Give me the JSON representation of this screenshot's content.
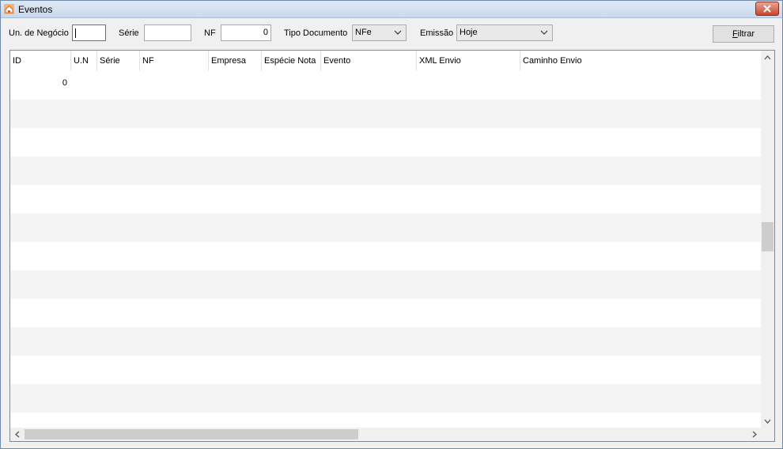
{
  "window": {
    "title": "Eventos",
    "icon": "app-house-icon",
    "close_icon": "close-icon"
  },
  "filters": {
    "unidade_label": "Un. de Negócio",
    "unidade_value": "",
    "serie_label": "Série",
    "serie_value": "",
    "nf_label": "NF",
    "nf_value": "0",
    "tipo_label": "Tipo Documento",
    "tipo_value": "NFe",
    "emissao_label": "Emissão",
    "emissao_value": "Hoje",
    "filtrar_prefix": "F",
    "filtrar_rest": "iltrar"
  },
  "grid": {
    "columns": [
      "ID",
      "U.N",
      "Série",
      "NF",
      "Empresa",
      "Espécie Nota",
      "Evento",
      "XML Envio",
      "Caminho Envio"
    ],
    "rows": [
      {
        "id": "0"
      }
    ],
    "row_colors": {
      "normal": "#ffffff",
      "alternate": "#f3f3f3"
    }
  },
  "scroll": {
    "vertical_position": 0.48,
    "horizontal_visible_fraction": 0.45
  },
  "colors": {
    "focus_border": "#3c7fb1",
    "close_button": "#c8472c"
  }
}
